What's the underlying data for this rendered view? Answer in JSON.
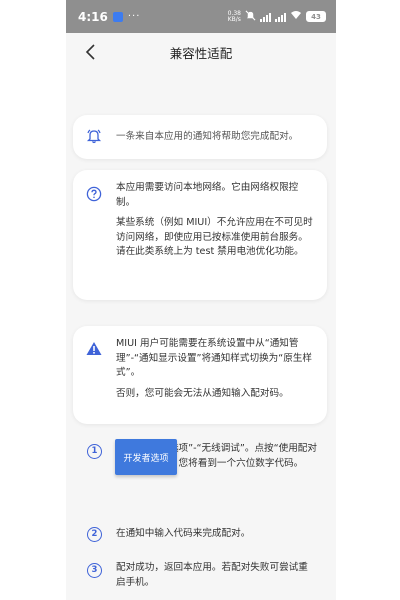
{
  "status_bar": {
    "time": "4:16",
    "dots": "···",
    "speed_value": "0.38",
    "speed_unit": "KB/s",
    "battery": "43"
  },
  "header": {
    "title": "兼容性适配"
  },
  "cards": {
    "notification": {
      "icon": "bell-icon",
      "text": "一条来自本应用的通知将帮助您完成配对。"
    },
    "network": {
      "icon": "help-circle-icon",
      "text1": "本应用需要访问本地网络。它由网络权限控制。",
      "text2": "某些系统（例如 MIUI）不允许应用在不可见时访问网络，即使应用已按标准使用前台服务。请在此类系统上为 test 禁用电池优化功能。"
    },
    "miui": {
      "icon": "warning-icon",
      "text1": "MIUI 用户可能需要在系统设置中从“通知管理”-“通知显示设置”将通知样式切换为“原生样式”。",
      "text2": "否则，您可能会无法从通知输入配对码。"
    }
  },
  "steps": [
    {
      "num": "1",
      "text": "进入“开发者选项”-“无线调试”。点按“使用配对码配对设备”，您将看到一个六位数字代码。"
    },
    {
      "num": "2",
      "text": "在通知中输入代码来完成配对。"
    },
    {
      "num": "3",
      "text": "配对成功，返回本应用。若配对失败可尝试重启手机。"
    }
  ],
  "developer_button": "开发者选项",
  "colors": {
    "accent": "#3f63d8",
    "button": "#3f79dd",
    "status_bar": "#8f8f8f",
    "background": "#f6f6f6"
  }
}
